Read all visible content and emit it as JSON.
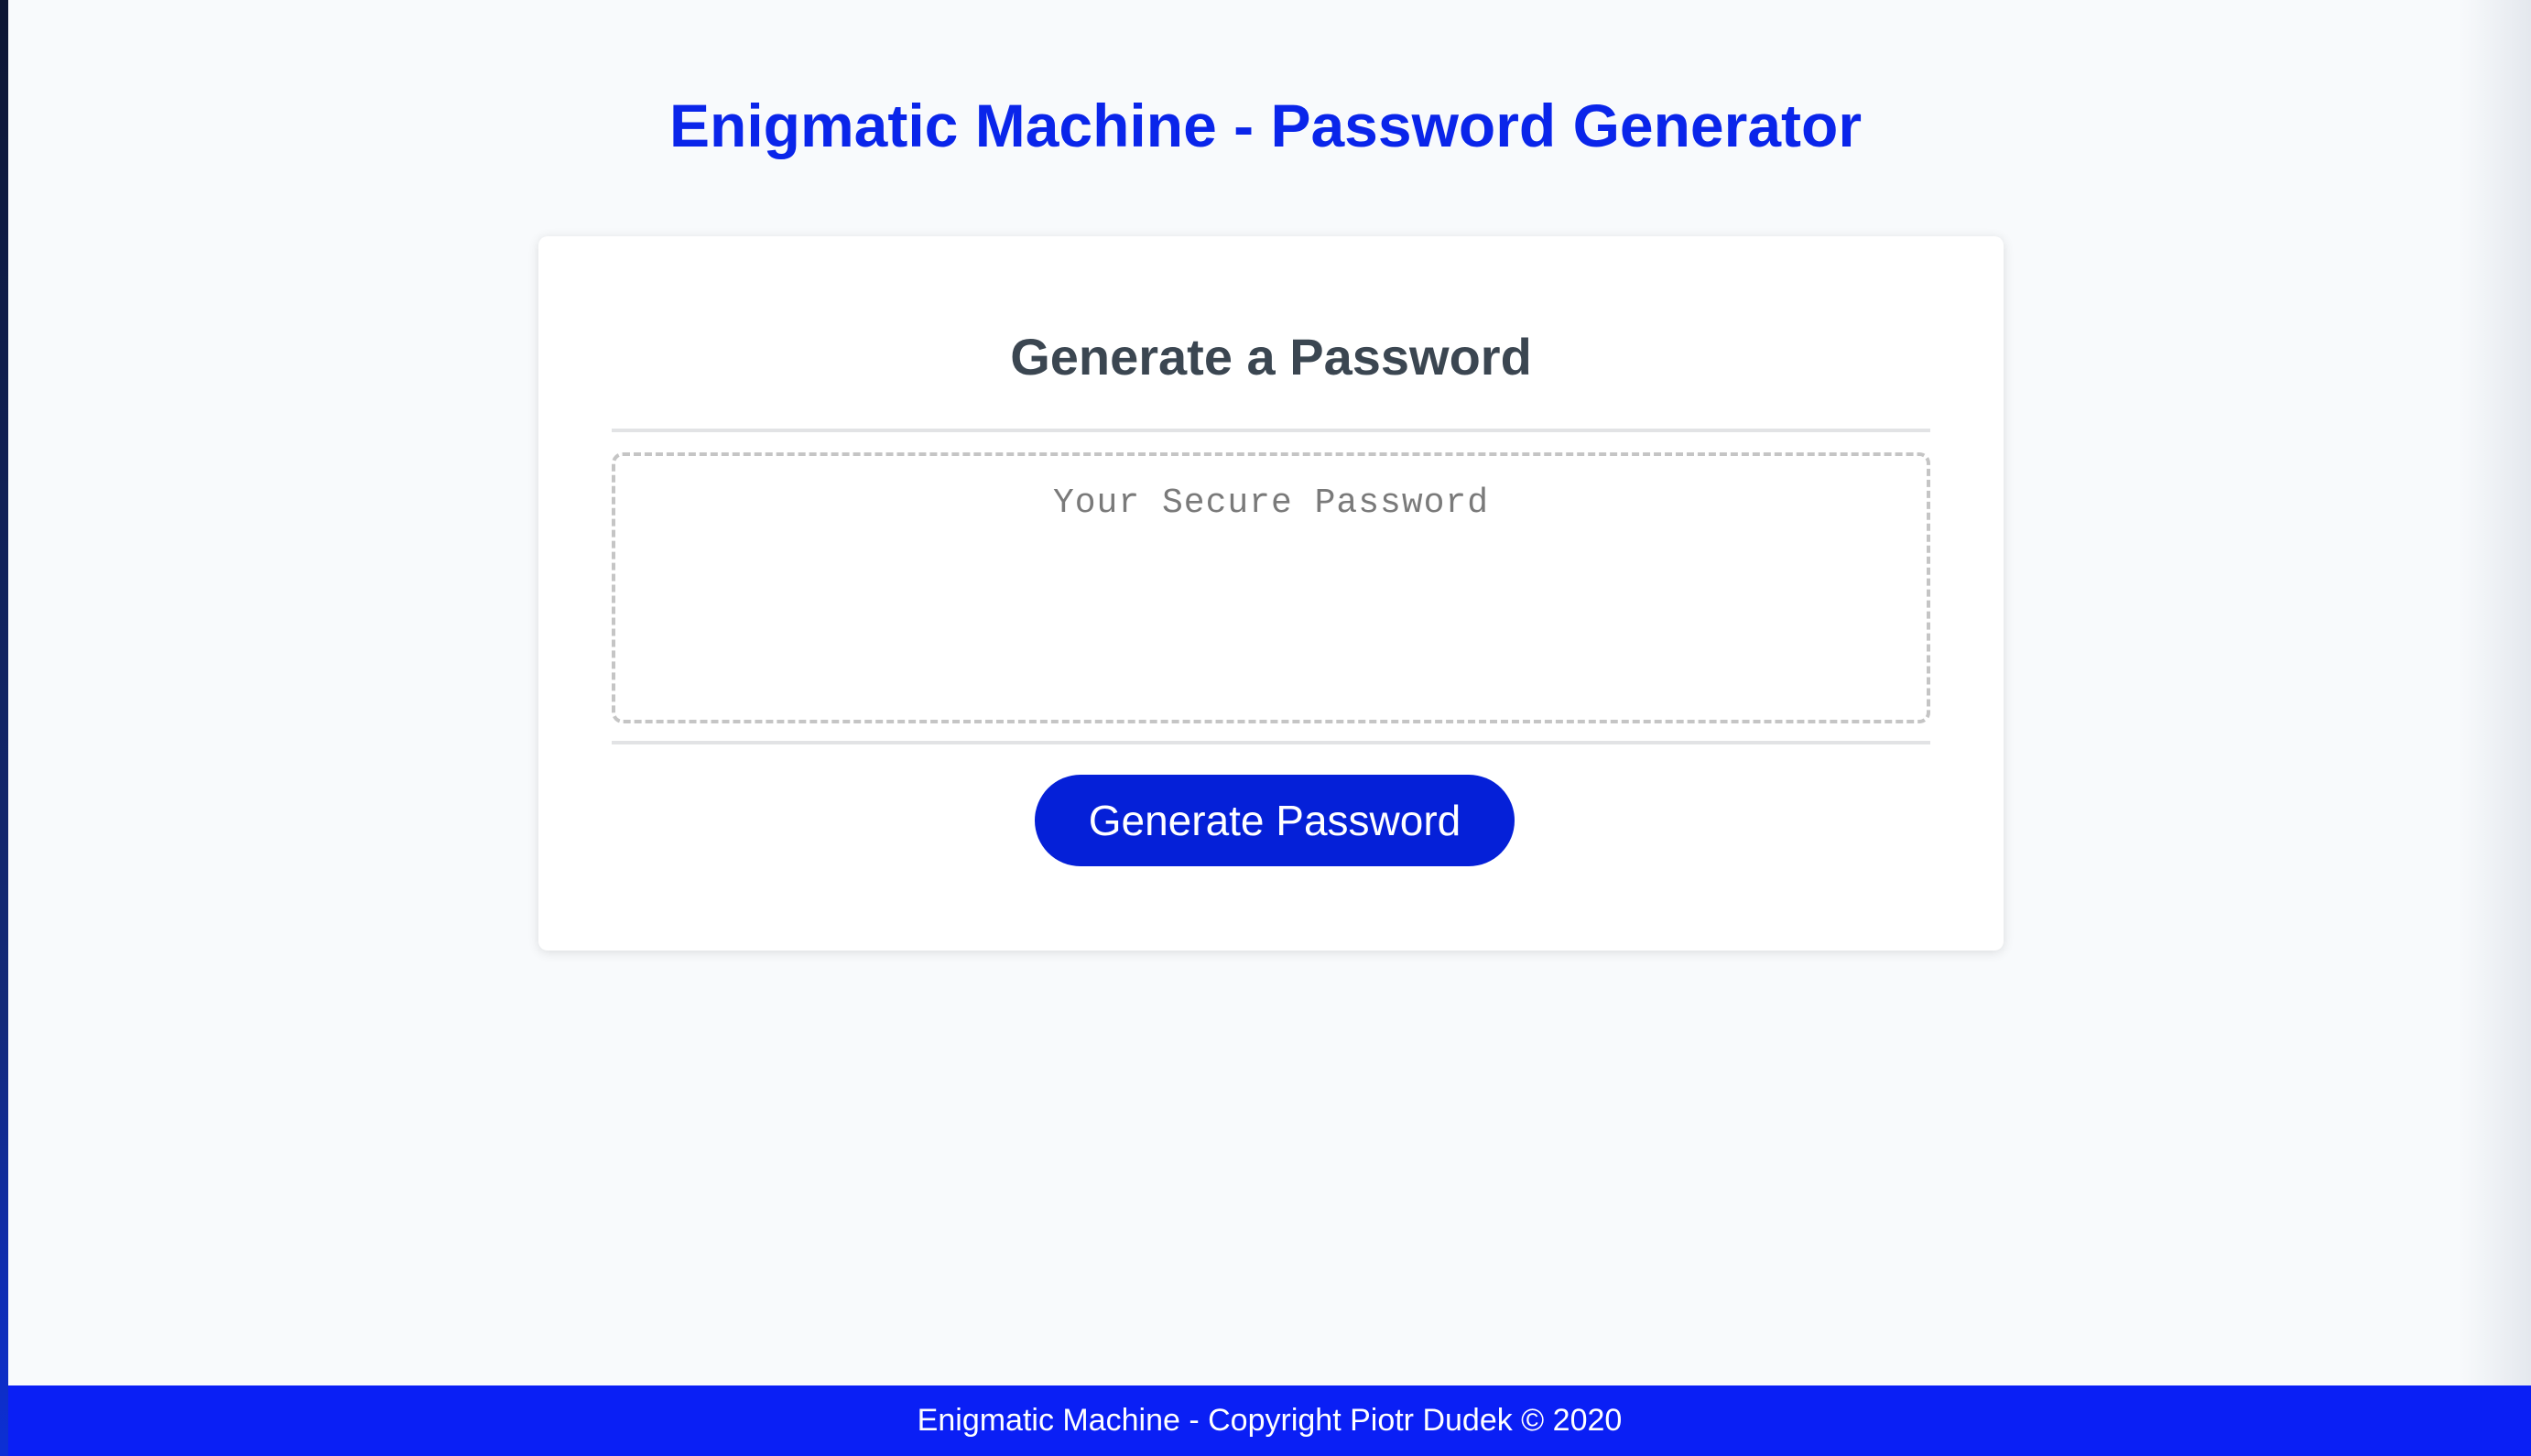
{
  "header": {
    "title": "Enigmatic Machine - Password Generator"
  },
  "card": {
    "title": "Generate a Password",
    "password_placeholder": "Your Secure Password",
    "password_value": "",
    "generate_button_label": "Generate Password"
  },
  "footer": {
    "text": "Enigmatic Machine - Copyright Piotr Dudek © 2020"
  },
  "colors": {
    "accent": "#0a25ea",
    "button": "#0520d8",
    "footer": "#0a1ff5",
    "card_title": "#3b4651",
    "background": "#f8fafc"
  }
}
